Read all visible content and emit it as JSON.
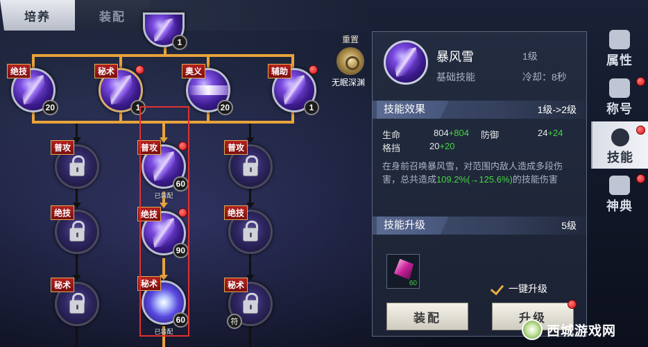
{
  "tabs": {
    "active": "培养",
    "inactive": "装配"
  },
  "tree": {
    "top_node_level": "1",
    "row1": [
      {
        "tag": "绝技",
        "level": "20",
        "dot": false
      },
      {
        "tag": "秘术",
        "level": "1",
        "dot": true
      },
      {
        "tag": "奥义",
        "level": "20",
        "dot": false
      },
      {
        "tag": "辅助",
        "level": "1",
        "dot": true
      }
    ],
    "col_left": [
      {
        "tag": "普攻"
      },
      {
        "tag": "绝技"
      },
      {
        "tag": "秘术"
      }
    ],
    "col_mid": [
      {
        "tag": "普攻",
        "level": "60",
        "status": "已装配",
        "dot": true
      },
      {
        "tag": "绝技",
        "level": "90",
        "dot": true
      },
      {
        "tag": "秘术",
        "level": "60",
        "status": "已装配"
      }
    ],
    "col_right": [
      {
        "tag": "普攻"
      },
      {
        "tag": "绝技"
      },
      {
        "tag": "秘术",
        "badge": "符"
      }
    ]
  },
  "reset": {
    "title": "重置",
    "name": "无眠深渊"
  },
  "skill": {
    "name": "暴风雪",
    "level": "1级",
    "type": "基础技能",
    "cooldown": "冷却：8秒"
  },
  "effect": {
    "title": "技能效果",
    "range": "1级->2级",
    "stats": [
      {
        "label": "生命",
        "base": "804",
        "plus": "+804"
      },
      {
        "label": "防御",
        "base": "24",
        "plus": "+24"
      },
      {
        "label": "格挡",
        "base": "20",
        "plus": "+20"
      }
    ],
    "desc_before": "在身前召唤暴风雪，对范围内敌人造成多段伤害，总共造成",
    "desc_highlight": "109.2%(→125.6%)",
    "desc_after": "的技能伤害"
  },
  "upgrade": {
    "title": "技能升级",
    "level": "5级",
    "item_count": "60",
    "onekey": "一键升级",
    "equip_btn": "装配",
    "upgrade_btn": "升级"
  },
  "sidebar": [
    {
      "label": "属性",
      "icon": "attribute-icon",
      "active": false,
      "dot": false
    },
    {
      "label": "称号",
      "icon": "title-icon",
      "active": false,
      "dot": true
    },
    {
      "label": "技能",
      "icon": "skill-icon",
      "active": true,
      "dot": true
    },
    {
      "label": "神典",
      "icon": "codex-icon",
      "active": false,
      "dot": true
    }
  ],
  "watermark": "西城游戏网",
  "colors": {
    "accent": "#e8a33a",
    "plus_green": "#45d845",
    "alert_red": "#d81010"
  }
}
